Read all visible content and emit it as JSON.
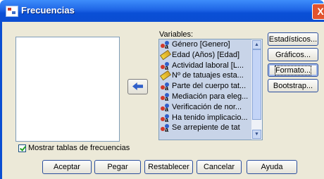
{
  "window": {
    "title": "Frecuencias",
    "close_label": "X"
  },
  "source_list": {
    "items": []
  },
  "variables": {
    "label": "Variables:",
    "items": [
      {
        "label": "Género [Genero]",
        "icon": "nominal-icon"
      },
      {
        "label": "Edad (Años) [Edad]",
        "icon": "scale-icon"
      },
      {
        "label": "Actividad laboral [L...",
        "icon": "nominal-icon"
      },
      {
        "label": "Nº de tatuajes esta...",
        "icon": "scale-icon"
      },
      {
        "label": "Parte del cuerpo tat...",
        "icon": "nominal-icon"
      },
      {
        "label": "Mediación para eleg...",
        "icon": "nominal-icon"
      },
      {
        "label": "Verificación de nor...",
        "icon": "nominal-icon"
      },
      {
        "label": "Ha tenido implicacio...",
        "icon": "nominal-icon"
      },
      {
        "label": "Se arrepiente de tat",
        "icon": "nominal-icon"
      }
    ]
  },
  "side_buttons": {
    "estadisticos": "Estadísticos...",
    "graficos": "Gráficos...",
    "formato": "Formato...",
    "bootstrap": "Bootstrap..."
  },
  "checkbox": {
    "label": "Mostrar tablas de frecuencias",
    "checked": true
  },
  "buttons": {
    "aceptar": "Aceptar",
    "pegar": "Pegar",
    "restablecer": "Restablecer",
    "cancelar": "Cancelar",
    "ayuda": "Ayuda"
  },
  "colors": {
    "titlebar": "#0b4ed2",
    "dialog_bg": "#ece9d8",
    "selection": "#c8d4e8",
    "close": "#e2532e"
  }
}
